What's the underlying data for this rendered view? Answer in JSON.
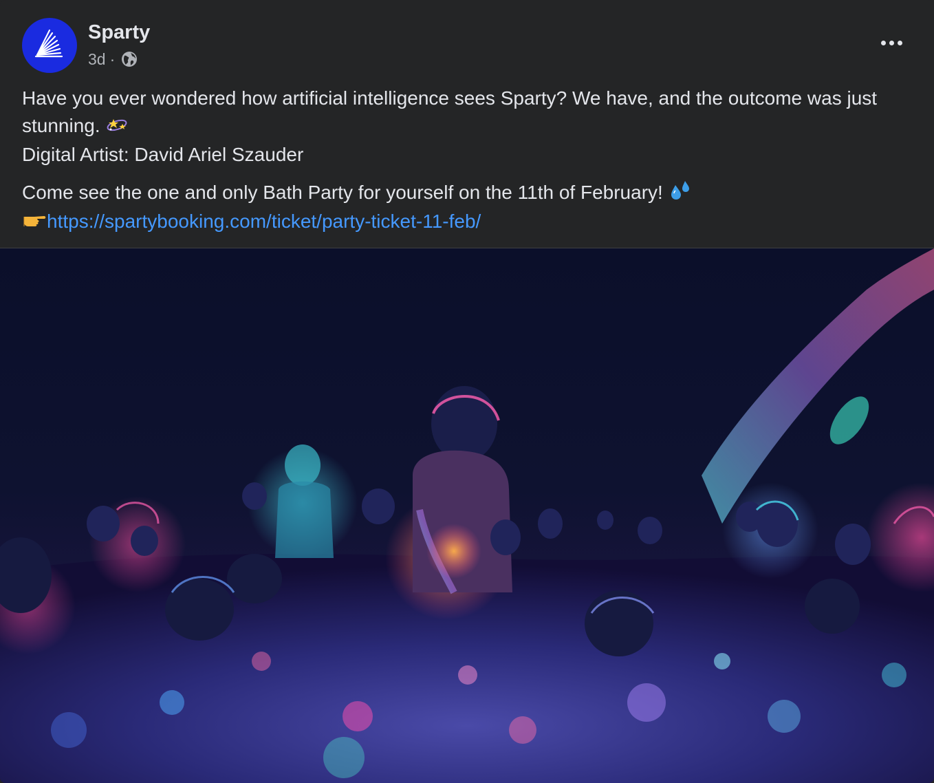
{
  "post": {
    "author": "Sparty",
    "time": "3d",
    "separator": "·",
    "privacy_icon": "globe-icon",
    "more_icon": "more-horizontal-icon",
    "line1": "Have you ever wondered how artificial intelligence sees Sparty? We have, and the outcome was just stunning.",
    "line1_emoji": "sparkles-stars-emoji",
    "line2": "Digital Artist: David Ariel Szauder",
    "line3": "Come see the one and only Bath Party for yourself on the 11th of February!",
    "line3_emoji": "sweat-droplets-emoji",
    "pointer_emoji": "backhand-index-pointing-right-emoji",
    "link": "https://spartybooking.com/ticket/party-ticket-11-feb/",
    "image_subject": "ai-art-neon-bath-party-image"
  },
  "colors": {
    "background": "#242526",
    "text": "#e4e6eb",
    "secondary_text": "#b0b3b8",
    "link": "#4599ff",
    "avatar": "#1a2be0"
  }
}
